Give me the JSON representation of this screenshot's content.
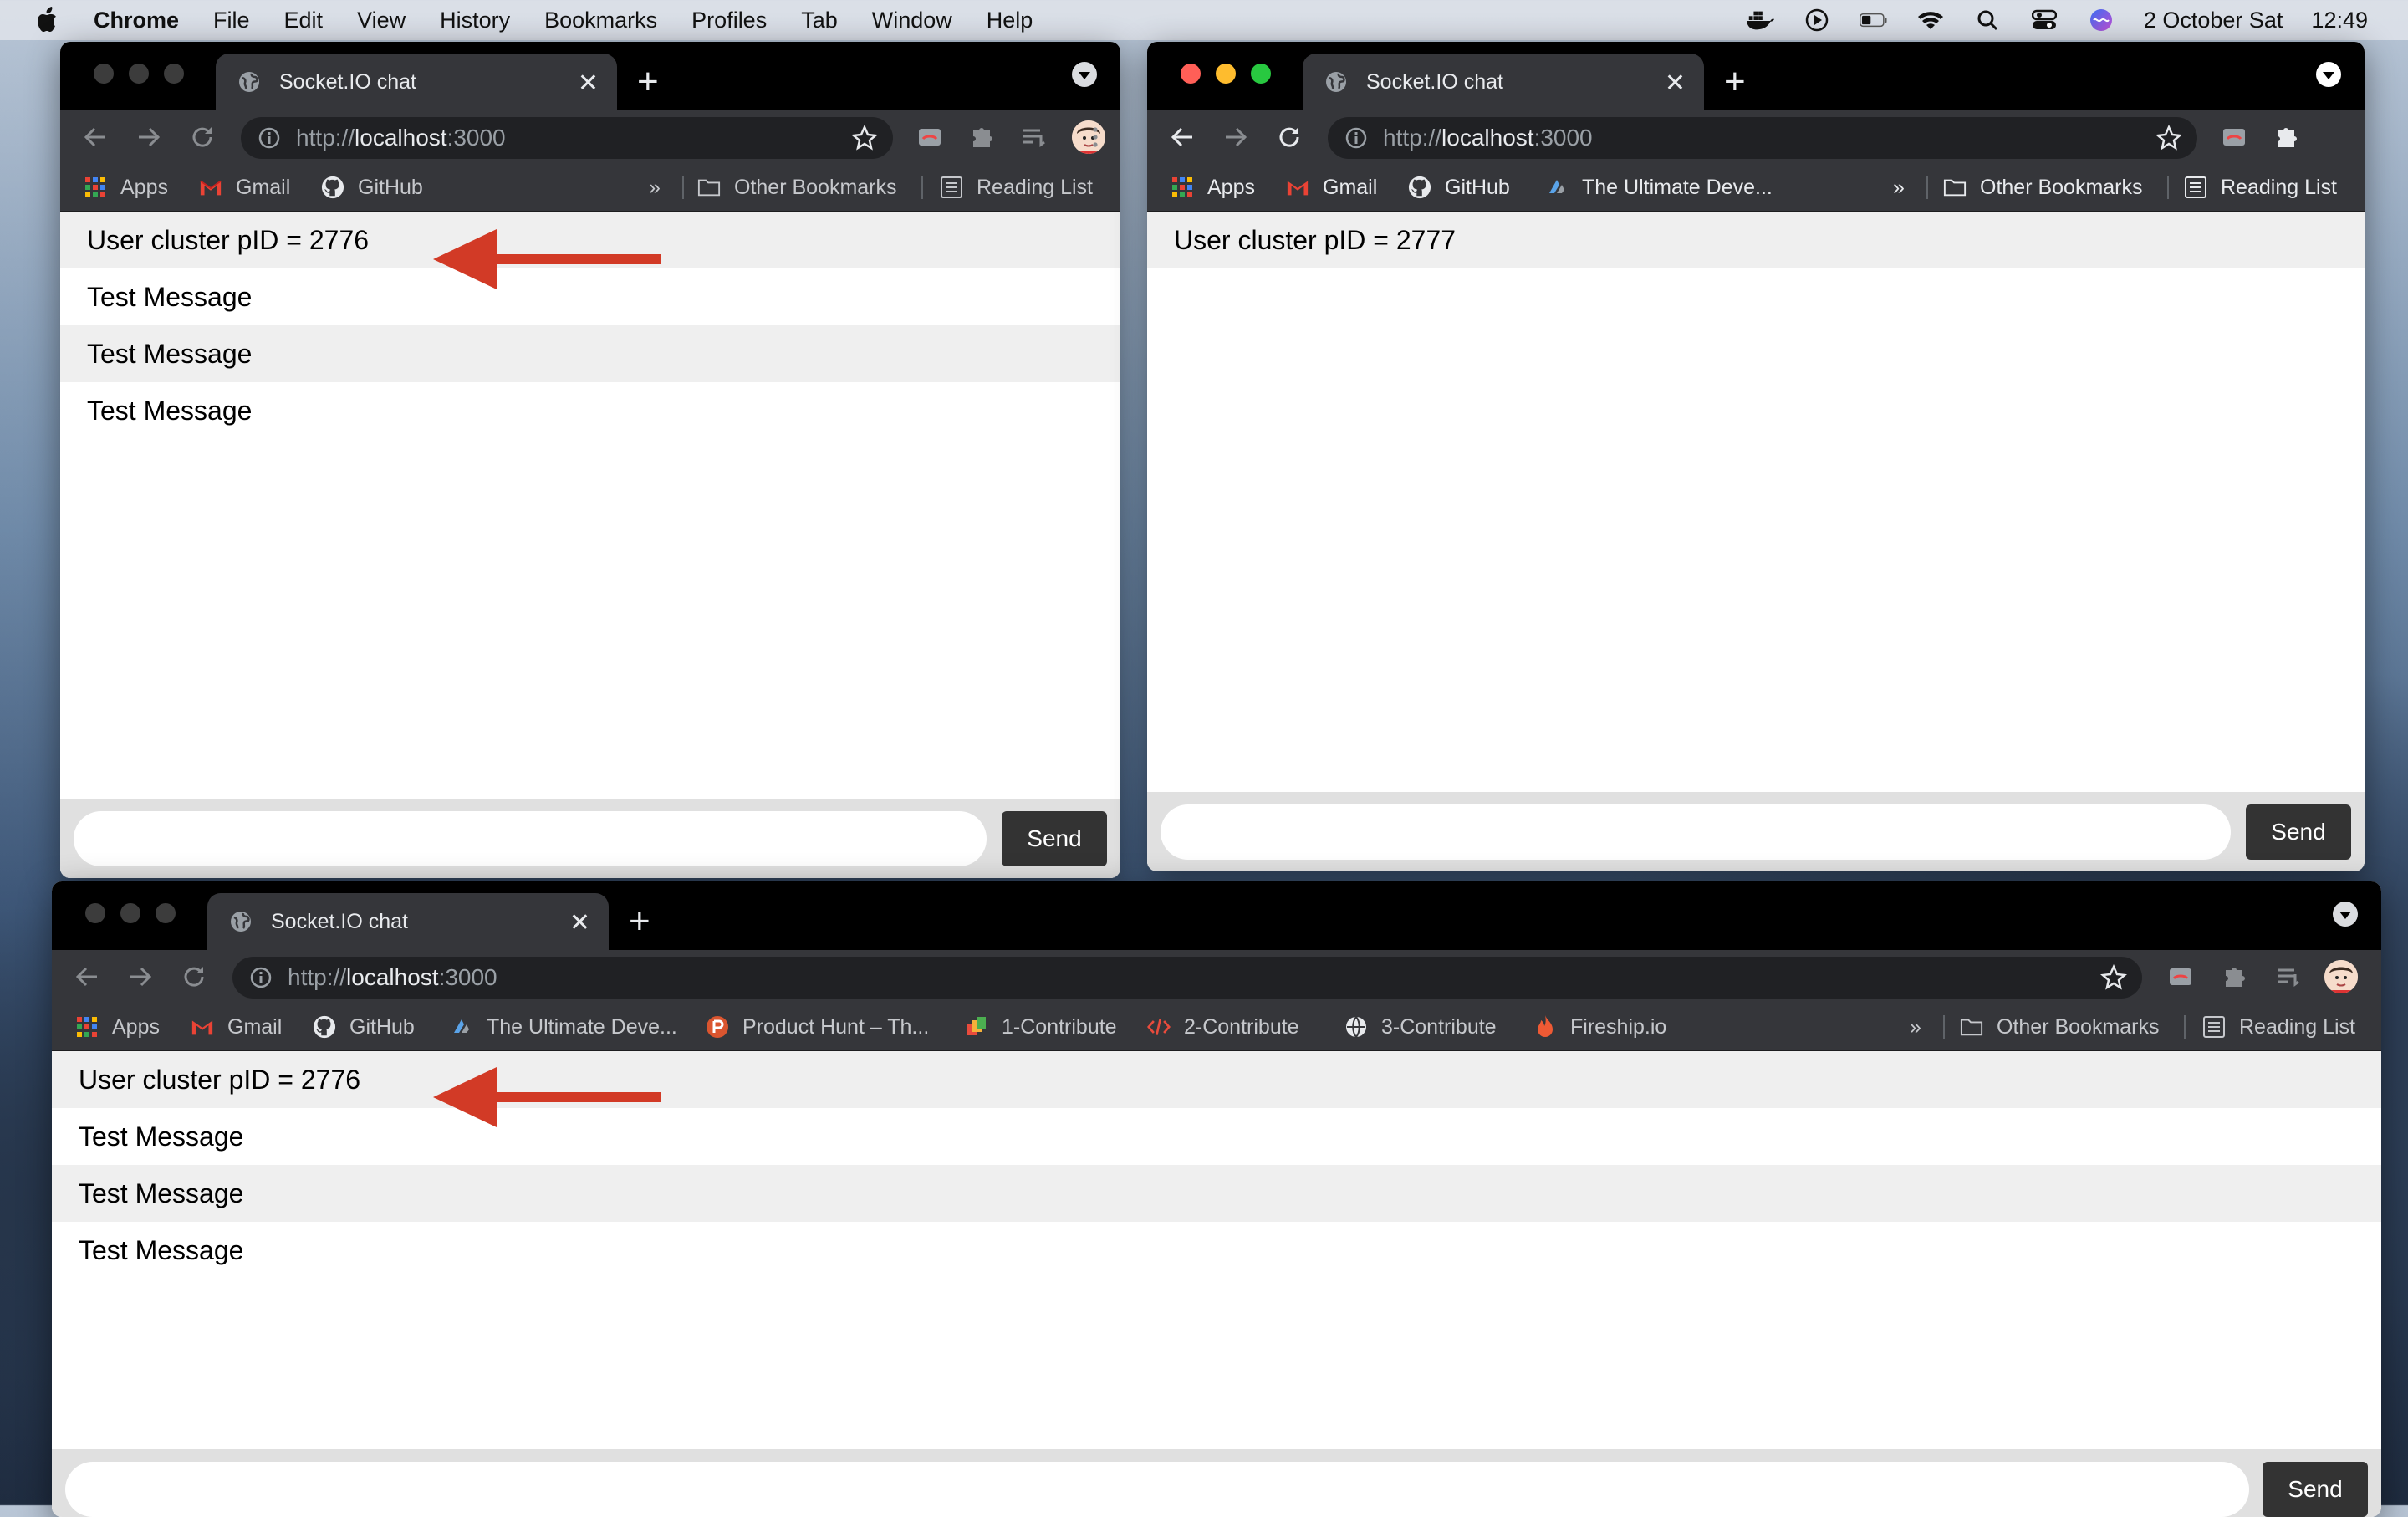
{
  "menubar": {
    "app": "Chrome",
    "items": [
      "File",
      "Edit",
      "View",
      "History",
      "Bookmarks",
      "Profiles",
      "Tab",
      "Window",
      "Help"
    ],
    "date": "2 October Sat",
    "time": "12:49"
  },
  "windows": [
    {
      "tab_title": "Socket.IO chat",
      "url_prefix": "http://",
      "url_host": "localhost",
      "url_port": ":3000",
      "bookmarks": [
        "Apps",
        "Gmail",
        "GitHub"
      ],
      "overflow": "»",
      "other_bookmarks": "Other Bookmarks",
      "reading_list": "Reading List",
      "messages": [
        "User cluster pID = 2776",
        "Test Message",
        "Test Message",
        "Test Message"
      ],
      "send_label": "Send",
      "highlighted": true
    },
    {
      "tab_title": "Socket.IO chat",
      "url_prefix": "http://",
      "url_host": "localhost",
      "url_port": ":3000",
      "bookmarks": [
        "Apps",
        "Gmail",
        "GitHub",
        "The Ultimate Deve..."
      ],
      "overflow": "»",
      "other_bookmarks": "Other Bookmarks",
      "reading_list": "Reading List",
      "messages": [
        "User cluster pID = 2777"
      ],
      "send_label": "Send",
      "active": true
    },
    {
      "tab_title": "Socket.IO chat",
      "url_prefix": "http://",
      "url_host": "localhost",
      "url_port": ":3000",
      "bookmarks": [
        "Apps",
        "Gmail",
        "GitHub",
        "The Ultimate Deve...",
        "Product Hunt – Th...",
        "1-Contribute",
        "2-Contribute",
        "3-Contribute",
        "Fireship.io"
      ],
      "overflow": "»",
      "other_bookmarks": "Other Bookmarks",
      "reading_list": "Reading List",
      "messages": [
        "User cluster pID = 2776",
        "Test Message",
        "Test Message",
        "Test Message"
      ],
      "send_label": "Send",
      "highlighted": true
    }
  ],
  "colors": {
    "arrow": "#d23a26",
    "tab": "#35363a",
    "titlebar": "#000000"
  }
}
